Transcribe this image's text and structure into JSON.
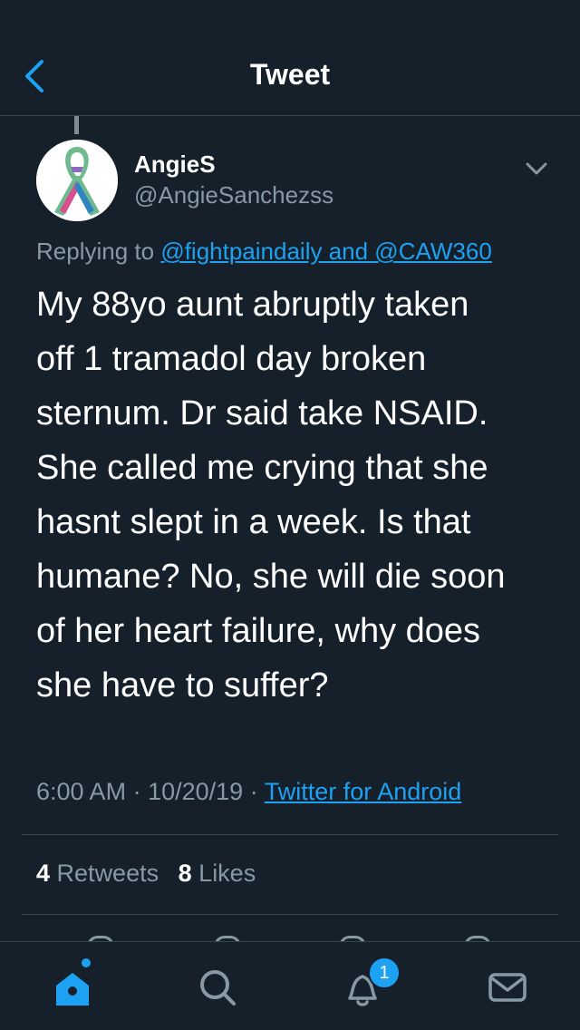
{
  "header": {
    "title": "Tweet",
    "back_icon": "chevron-left-icon"
  },
  "author": {
    "name": "AngieS",
    "handle": "@AngieSanchezss",
    "avatar_icon": "awareness-ribbon-icon"
  },
  "reply": {
    "prefix": "Replying to",
    "mentions": "@fightpaindaily and @CAW360"
  },
  "tweet": {
    "text": "My 88yo aunt abruptly taken\noff 1 tramadol day broken\nsternum. Dr said take NSAID.\nShe called me crying that she\nhasnt slept in a week. Is that\nhumane? No, she will die soon\nof her heart failure, why does\nshe have to suffer?",
    "time": "6:00 AM",
    "date": "10/20/19",
    "source": "Twitter for Android"
  },
  "stats": {
    "retweets_count": "4",
    "retweets_label": "Retweets",
    "likes_count": "8",
    "likes_label": "Likes"
  },
  "tabbar": {
    "items": [
      {
        "icon": "home-icon",
        "active": true
      },
      {
        "icon": "search-icon",
        "active": false
      },
      {
        "icon": "notifications-bell-icon",
        "active": false
      },
      {
        "icon": "messages-envelope-icon",
        "active": false
      }
    ],
    "notification_badge": "1"
  },
  "colors": {
    "background": "#15202b",
    "accent": "#1da1f2",
    "secondary_text": "#8899a6",
    "divider": "#38444d"
  }
}
